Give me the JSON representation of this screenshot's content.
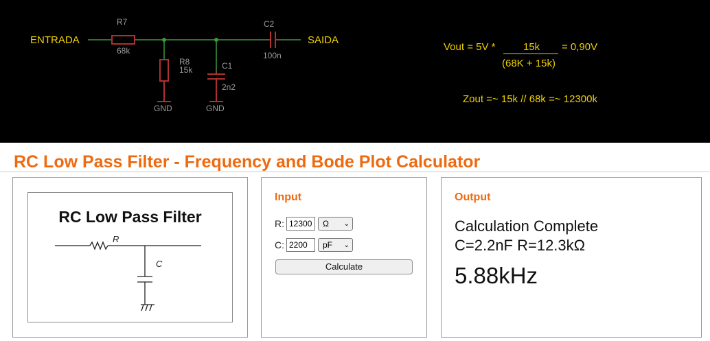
{
  "schematic": {
    "labels": {
      "input": "ENTRADA",
      "output": "SAIDA",
      "r7_name": "R7",
      "r7_value": "68k",
      "r8_name": "R8",
      "r8_value": "15k",
      "c1_name": "C1",
      "c1_value": "2n2",
      "c2_name": "C2",
      "c2_value": "100n",
      "gnd1": "GND",
      "gnd2": "GND"
    },
    "colors": {
      "wire": "#3a9a3a",
      "component": "#b03030",
      "text": "#f0d000",
      "background": "#000000"
    },
    "equations": {
      "vout_prefix": "Vout = 5V *",
      "vout_numerator": "15k",
      "vout_result": "= 0,90V",
      "vout_denominator": "(68K + 15k)",
      "zout": "Zout =~ 15k // 68k =~ 12300k"
    }
  },
  "page": {
    "title": "RC Low Pass Filter - Frequency and Bode Plot Calculator",
    "accent_color": "#ee6a10"
  },
  "diagram": {
    "title": "RC Low Pass Filter",
    "r_label": "R",
    "c_label": "C"
  },
  "input_panel": {
    "heading": "Input",
    "r_label": "R:",
    "r_value": "12300",
    "r_unit": "Ω",
    "c_label": "C:",
    "c_value": "2200",
    "c_unit": "pF",
    "calculate_label": "Calculate"
  },
  "output_panel": {
    "heading": "Output",
    "status": "Calculation Complete",
    "summary": "C=2.2nF R=12.3kΩ",
    "result": "5.88kHz"
  }
}
